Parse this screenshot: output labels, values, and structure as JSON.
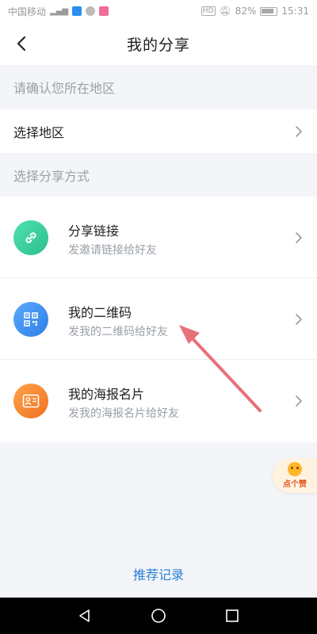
{
  "status_bar": {
    "carrier": "中国移动",
    "signal_text": "⁴ᴳ",
    "battery": "82%",
    "time": "15:31",
    "hd": "HD"
  },
  "header": {
    "title": "我的分享"
  },
  "region": {
    "section_label": "请确认您所在地区",
    "row_label": "选择地区"
  },
  "share": {
    "section_label": "选择分享方式",
    "items": [
      {
        "title": "分享链接",
        "subtitle": "发邀请链接给好友",
        "icon": "link-icon",
        "color": "#3ccfa0"
      },
      {
        "title": "我的二维码",
        "subtitle": "发我的二维码给好友",
        "icon": "qrcode-icon",
        "color": "#3d8ff0"
      },
      {
        "title": "我的海报名片",
        "subtitle": "发我的海报名片给好友",
        "icon": "poster-card-icon",
        "color": "#f2822a"
      }
    ]
  },
  "like_sticker": {
    "text": "点个赞"
  },
  "footer": {
    "history_link": "推荐记录"
  },
  "colors": {
    "accent_link": "#2a7fd6",
    "annotation_arrow": "#e8707a",
    "background": "#f3f5f8"
  }
}
